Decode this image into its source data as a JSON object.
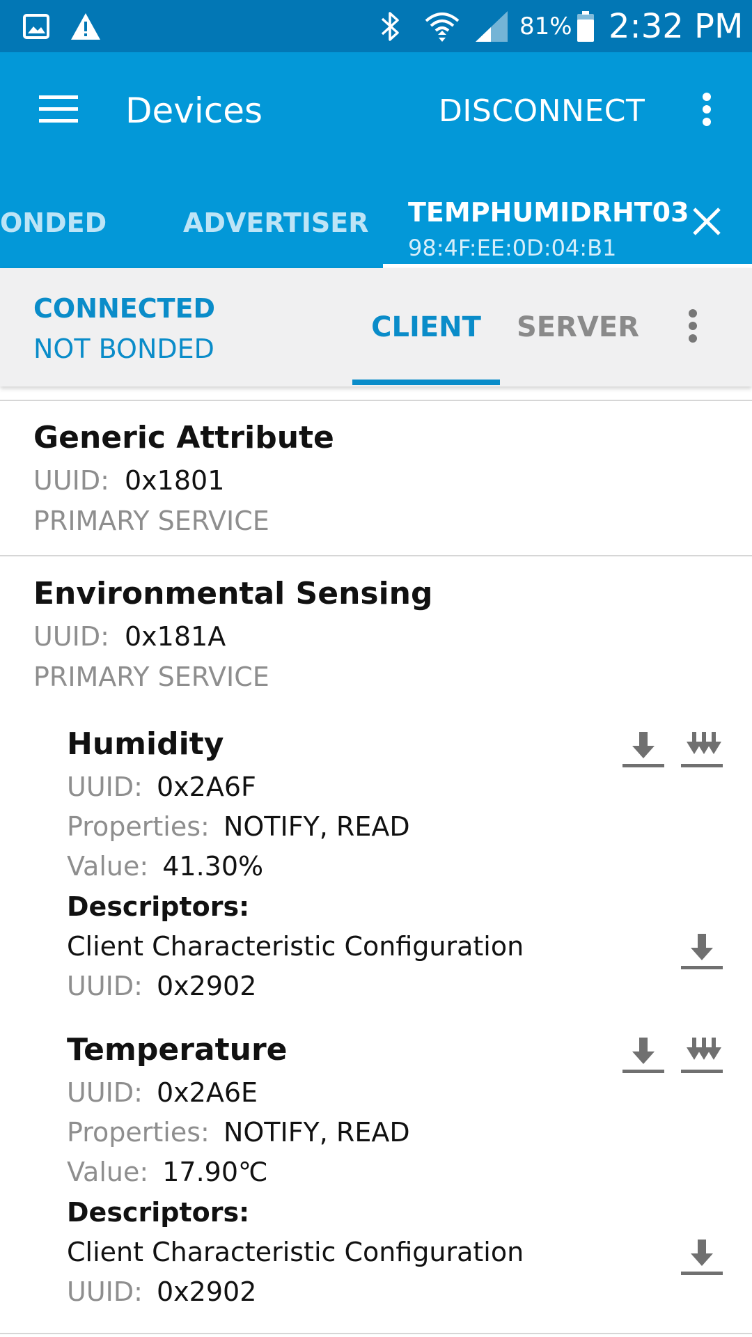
{
  "status_bar": {
    "icons": [
      "image-icon",
      "warning-icon",
      "bluetooth-icon",
      "wifi-icon",
      "signal-icon",
      "battery-icon"
    ],
    "battery_percent": "81%",
    "time": "2:32 PM"
  },
  "app_bar": {
    "title": "Devices",
    "disconnect_label": "DISCONNECT"
  },
  "tabs": {
    "bonded_label": "ONDED",
    "advertiser_label": "ADVERTISER",
    "device_name": "TEMPHUMIDRHT03",
    "device_mac": "98:4F:EE:0D:04:B1"
  },
  "connection": {
    "state": "CONNECTED",
    "bond_state": "NOT BONDED",
    "client_label": "CLIENT",
    "server_label": "SERVER"
  },
  "labels": {
    "uuid": "UUID:",
    "properties": "Properties:",
    "value": "Value:",
    "descriptors": "Descriptors:"
  },
  "services": [
    {
      "name": "Generic Attribute",
      "uuid": "0x1801",
      "type": "PRIMARY SERVICE"
    },
    {
      "name": "Environmental Sensing",
      "uuid": "0x181A",
      "type": "PRIMARY SERVICE",
      "characteristics": [
        {
          "name": "Humidity",
          "uuid": "0x2A6F",
          "properties": "NOTIFY, READ",
          "value": "41.30%",
          "descriptor_name": "Client Characteristic Configuration",
          "descriptor_uuid": "0x2902"
        },
        {
          "name": "Temperature",
          "uuid": "0x2A6E",
          "properties": "NOTIFY, READ",
          "value": "17.90℃",
          "descriptor_name": "Client Characteristic Configuration",
          "descriptor_uuid": "0x2902"
        }
      ]
    }
  ],
  "colors": {
    "status_bar": "#0277b5",
    "app_bar": "#0398d8",
    "accent": "#0a8cc9",
    "secondary_text": "#8e8e8e",
    "sub_bar": "#f0f0f1"
  }
}
